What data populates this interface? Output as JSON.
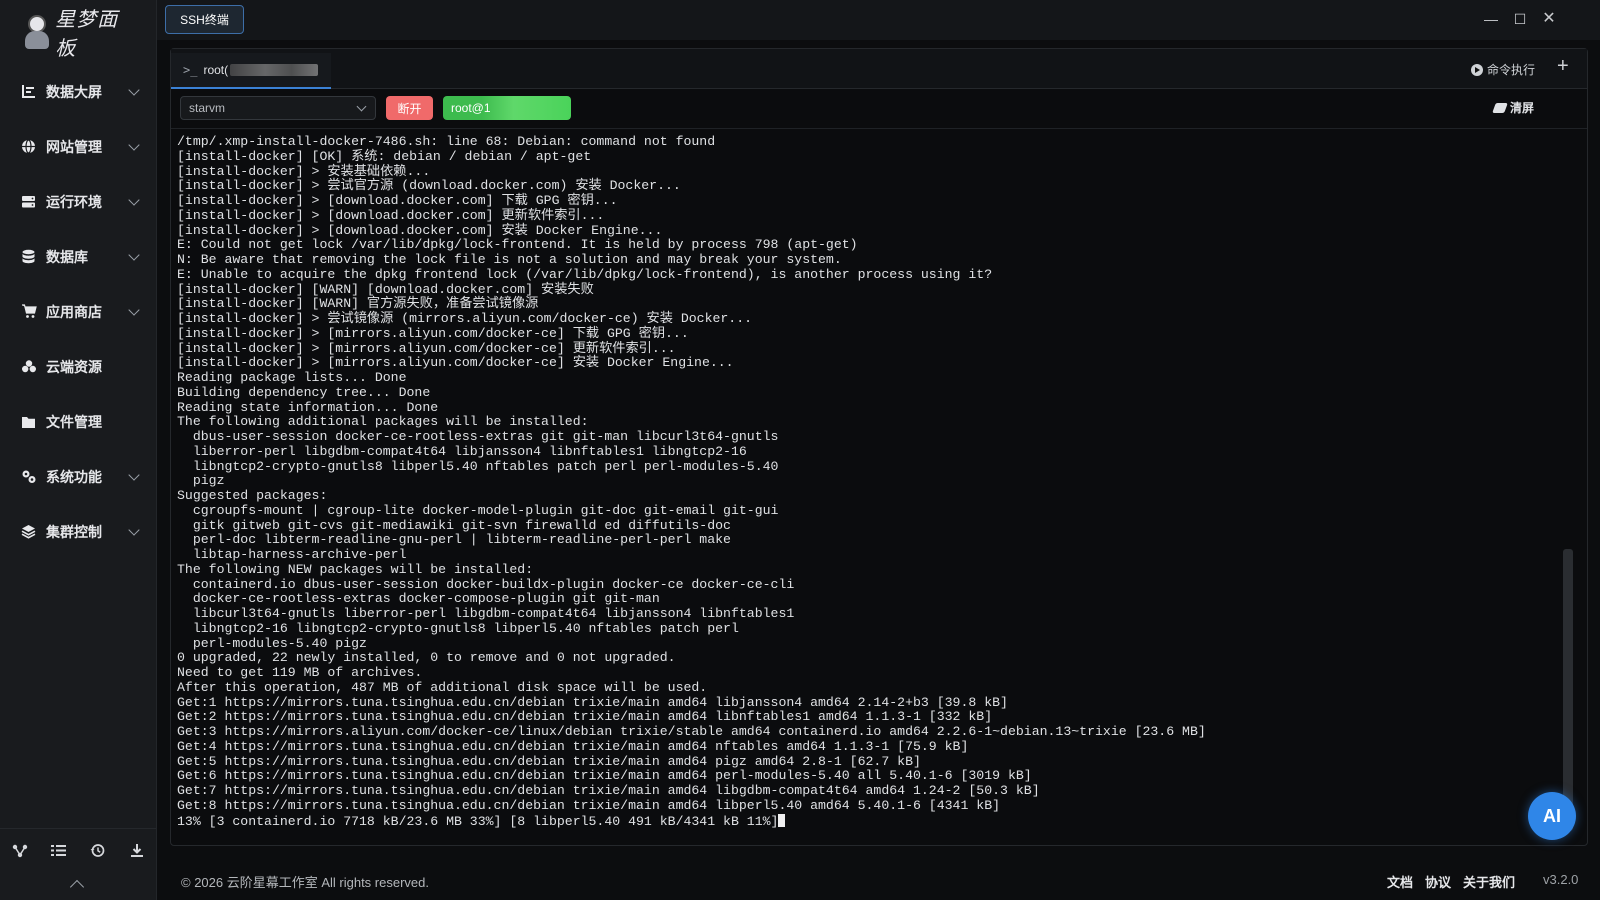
{
  "app": {
    "logo_text": "星梦面板"
  },
  "sidebar": {
    "items": [
      {
        "label": "数据大屏",
        "icon": "chart-icon",
        "has_chevron": true
      },
      {
        "label": "网站管理",
        "icon": "globe-icon",
        "has_chevron": true
      },
      {
        "label": "运行环境",
        "icon": "server-icon",
        "has_chevron": true
      },
      {
        "label": "数据库",
        "icon": "database-icon",
        "has_chevron": true
      },
      {
        "label": "应用商店",
        "icon": "cart-icon",
        "has_chevron": true
      },
      {
        "label": "云端资源",
        "icon": "cloud-icon",
        "has_chevron": false
      },
      {
        "label": "文件管理",
        "icon": "folder-icon",
        "has_chevron": false
      },
      {
        "label": "系统功能",
        "icon": "gears-icon",
        "has_chevron": true
      },
      {
        "label": "集群控制",
        "icon": "layers-icon",
        "has_chevron": true
      }
    ],
    "tools": [
      "connections-icon",
      "list-icon",
      "history-icon",
      "download-icon"
    ]
  },
  "topbar": {
    "tab_label": "SSH终端"
  },
  "panel": {
    "session_tab": "root(",
    "cmd_exec_label": "命令执行",
    "server_select": "starvm",
    "disconnect_label": "断开",
    "connection_label": "root@1",
    "clear_label": "清屏"
  },
  "terminal": {
    "lines": [
      "/tmp/.xmp-install-docker-7486.sh: line 68: Debian: command not found",
      "[install-docker] [OK] 系统: debian / debian / apt-get",
      "[install-docker] > 安装基础依赖...",
      "[install-docker] > 尝试官方源 (download.docker.com) 安装 Docker...",
      "[install-docker] > [download.docker.com] 下载 GPG 密钥...",
      "[install-docker] > [download.docker.com] 更新软件索引...",
      "[install-docker] > [download.docker.com] 安装 Docker Engine...",
      "E: Could not get lock /var/lib/dpkg/lock-frontend. It is held by process 798 (apt-get)",
      "N: Be aware that removing the lock file is not a solution and may break your system.",
      "E: Unable to acquire the dpkg frontend lock (/var/lib/dpkg/lock-frontend), is another process using it?",
      "[install-docker] [WARN] [download.docker.com] 安装失败",
      "[install-docker] [WARN] 官方源失败，准备尝试镜像源",
      "[install-docker] > 尝试镜像源 (mirrors.aliyun.com/docker-ce) 安装 Docker...",
      "[install-docker] > [mirrors.aliyun.com/docker-ce] 下载 GPG 密钥...",
      "[install-docker] > [mirrors.aliyun.com/docker-ce] 更新软件索引...",
      "[install-docker] > [mirrors.aliyun.com/docker-ce] 安装 Docker Engine...",
      "Reading package lists... Done",
      "Building dependency tree... Done",
      "Reading state information... Done",
      "The following additional packages will be installed:",
      "  dbus-user-session docker-ce-rootless-extras git git-man libcurl3t64-gnutls",
      "  liberror-perl libgdbm-compat4t64 libjansson4 libnftables1 libngtcp2-16",
      "  libngtcp2-crypto-gnutls8 libperl5.40 nftables patch perl perl-modules-5.40",
      "  pigz",
      "Suggested packages:",
      "  cgroupfs-mount | cgroup-lite docker-model-plugin git-doc git-email git-gui",
      "  gitk gitweb git-cvs git-mediawiki git-svn firewalld ed diffutils-doc",
      "  perl-doc libterm-readline-gnu-perl | libterm-readline-perl-perl make",
      "  libtap-harness-archive-perl",
      "The following NEW packages will be installed:",
      "  containerd.io dbus-user-session docker-buildx-plugin docker-ce docker-ce-cli",
      "  docker-ce-rootless-extras docker-compose-plugin git git-man",
      "  libcurl3t64-gnutls liberror-perl libgdbm-compat4t64 libjansson4 libnftables1",
      "  libngtcp2-16 libngtcp2-crypto-gnutls8 libperl5.40 nftables patch perl",
      "  perl-modules-5.40 pigz",
      "0 upgraded, 22 newly installed, 0 to remove and 0 not upgraded.",
      "Need to get 119 MB of archives.",
      "After this operation, 487 MB of additional disk space will be used.",
      "Get:1 https://mirrors.tuna.tsinghua.edu.cn/debian trixie/main amd64 libjansson4 amd64 2.14-2+b3 [39.8 kB]",
      "Get:2 https://mirrors.tuna.tsinghua.edu.cn/debian trixie/main amd64 libnftables1 amd64 1.1.3-1 [332 kB]",
      "Get:3 https://mirrors.aliyun.com/docker-ce/linux/debian trixie/stable amd64 containerd.io amd64 2.2.6-1~debian.13~trixie [23.6 MB]",
      "Get:4 https://mirrors.tuna.tsinghua.edu.cn/debian trixie/main amd64 nftables amd64 1.1.3-1 [75.9 kB]",
      "Get:5 https://mirrors.tuna.tsinghua.edu.cn/debian trixie/main amd64 pigz amd64 2.8-1 [62.7 kB]",
      "Get:6 https://mirrors.tuna.tsinghua.edu.cn/debian trixie/main amd64 perl-modules-5.40 all 5.40.1-6 [3019 kB]",
      "Get:7 https://mirrors.tuna.tsinghua.edu.cn/debian trixie/main amd64 libgdbm-compat4t64 amd64 1.24-2 [50.3 kB]",
      "Get:8 https://mirrors.tuna.tsinghua.edu.cn/debian trixie/main amd64 libperl5.40 amd64 5.40.1-6 [4341 kB]"
    ],
    "last_line": "13% [3 containerd.io 7718 kB/23.6 MB 33%] [8 libperl5.40 491 kB/4341 kB 11%]"
  },
  "ai_button": "AI",
  "footer": {
    "copyright": "© 2026 云阶星幕工作室 All rights reserved.",
    "links": [
      "文档",
      "协议",
      "关于我们"
    ],
    "version": "v3.2.0"
  }
}
